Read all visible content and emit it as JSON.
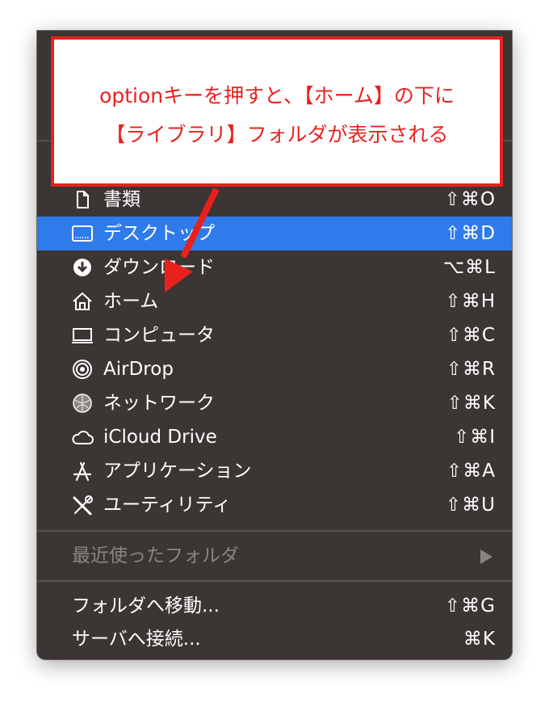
{
  "annotation": {
    "line1": "optionキーを押すと、【ホーム】の下に",
    "line2": "【ライブラリ】フォルダが表示される",
    "color": "#e8211d"
  },
  "menu": {
    "items": [
      {
        "label": "書類",
        "shortcut": "⇧⌘O",
        "icon": "document-icon"
      },
      {
        "label": "デスクトップ",
        "shortcut": "⇧⌘D",
        "icon": "desktop-icon",
        "highlighted": true
      },
      {
        "label": "ダウンロード",
        "shortcut": "⌥⌘L",
        "icon": "download-icon"
      },
      {
        "label": "ホーム",
        "shortcut": "⇧⌘H",
        "icon": "home-icon"
      },
      {
        "label": "コンピュータ",
        "shortcut": "⇧⌘C",
        "icon": "computer-icon"
      },
      {
        "label": "AirDrop",
        "shortcut": "⇧⌘R",
        "icon": "airdrop-icon"
      },
      {
        "label": "ネットワーク",
        "shortcut": "⇧⌘K",
        "icon": "network-icon"
      },
      {
        "label": "iCloud Drive",
        "shortcut": "⇧⌘I",
        "icon": "cloud-icon"
      },
      {
        "label": "アプリケーション",
        "shortcut": "⇧⌘A",
        "icon": "applications-icon"
      },
      {
        "label": "ユーティリティ",
        "shortcut": "⇧⌘U",
        "icon": "utilities-icon"
      }
    ],
    "recent": {
      "label": "最近使ったフォルダ",
      "icon": "submenu-arrow-icon"
    },
    "goto": {
      "label": "フォルダへ移動...",
      "shortcut": "⇧⌘G"
    },
    "connect": {
      "label": "サーバへ接続...",
      "shortcut": "⌘K"
    }
  },
  "colors": {
    "menu_background": "#3b3534",
    "highlight": "#2f7bec",
    "text": "#ffffff",
    "disabled_text": "#898382",
    "annotation_red": "#e8211d"
  }
}
